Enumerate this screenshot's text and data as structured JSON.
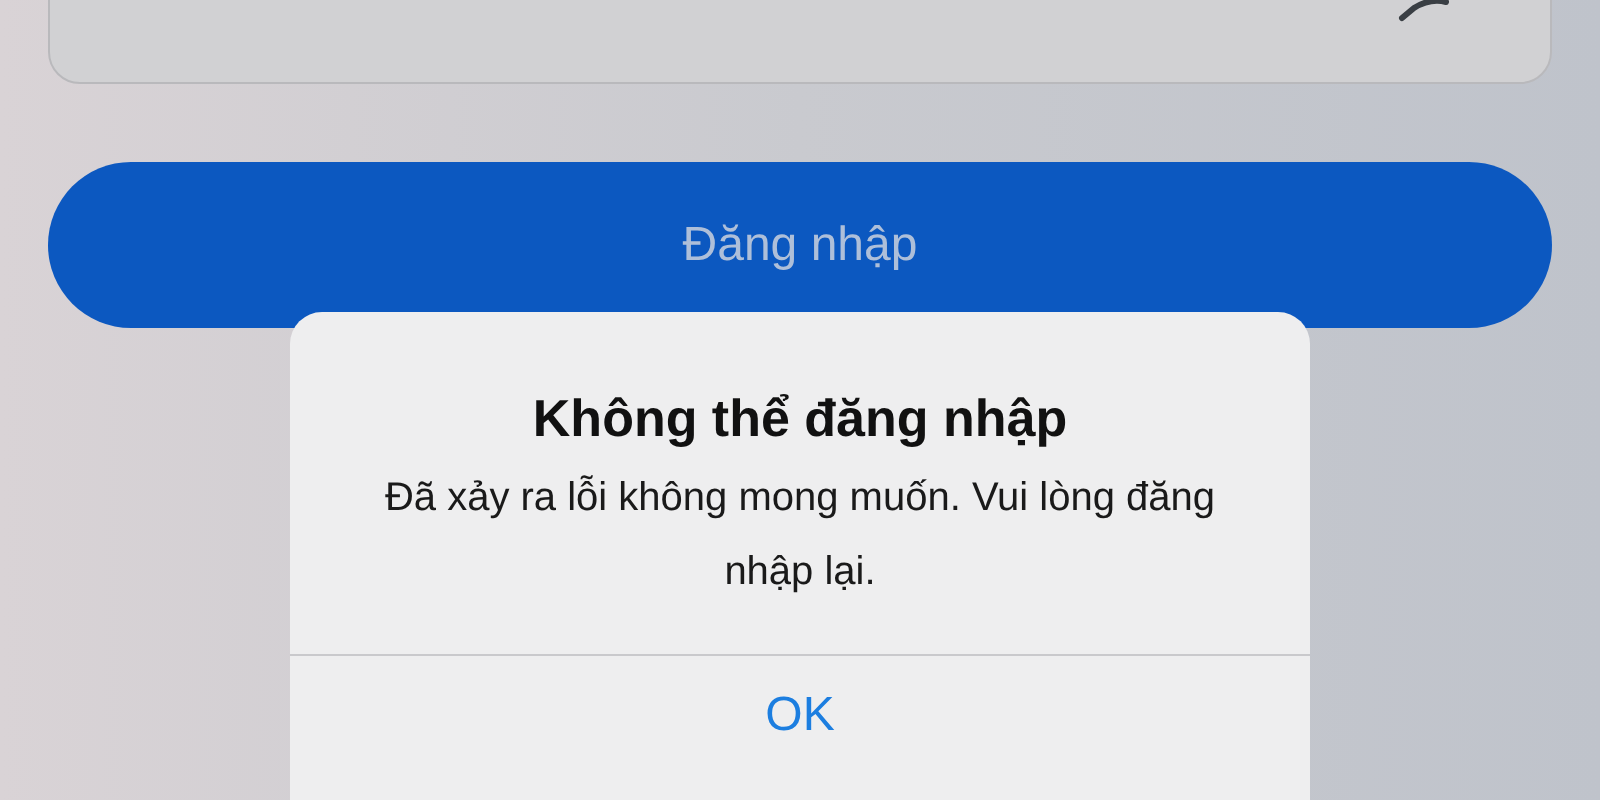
{
  "field": {
    "trailing_icon": true
  },
  "login_button": {
    "label": "Đăng nhập",
    "disabled": true
  },
  "alert": {
    "title": "Không thể đăng nhập",
    "message": "Đã xảy ra lỗi không mong muốn. Vui lòng đăng nhập lại.",
    "buttons": [
      "OK"
    ]
  }
}
